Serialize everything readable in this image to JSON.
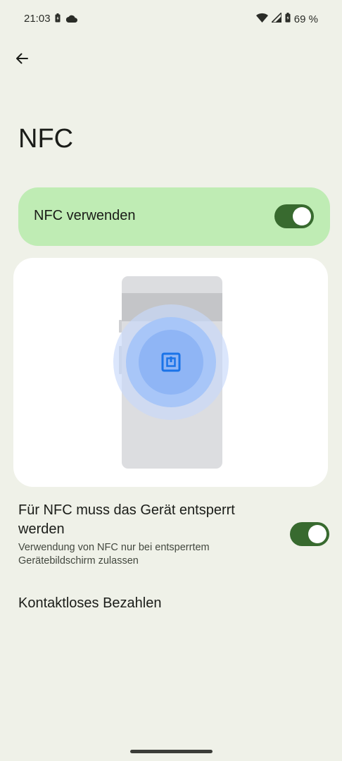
{
  "status_bar": {
    "time": "21:03",
    "battery_percent": "69 %",
    "icons": [
      "battery-saver-icon",
      "cloud-icon",
      "wifi-icon",
      "cell-signal-icon",
      "battery-icon"
    ]
  },
  "toolbar": {
    "back_icon": "arrow-back-icon"
  },
  "page": {
    "title": "NFC"
  },
  "main_switch": {
    "label": "NFC verwenden",
    "checked": true
  },
  "illustration": {
    "icon": "nfc-tag-icon"
  },
  "settings": {
    "require_unlock": {
      "title": "Für NFC muss das Gerät entsperrt werden",
      "summary": "Verwendung von NFC nur bei entsperrtem Gerätebildschirm zulassen",
      "checked": true
    },
    "contactless_payments": {
      "title": "Kontaktloses Bezahlen"
    }
  },
  "colors": {
    "background": "#eff1e8",
    "switch_card": "#bfecb4",
    "toggle_track": "#386a2f",
    "nfc_accent": "#1a73e8"
  }
}
